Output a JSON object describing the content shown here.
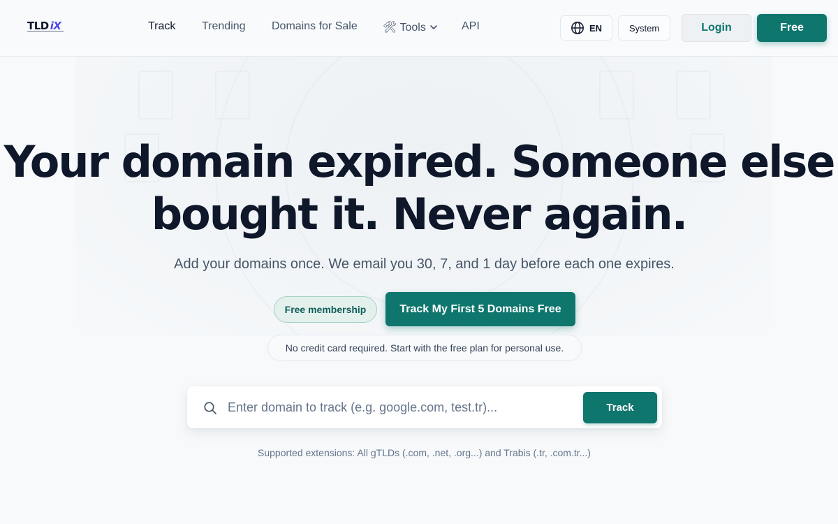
{
  "brand": {
    "logo_text": "TLD",
    "logo_accent": "iX"
  },
  "nav": {
    "items": [
      {
        "label": "Track"
      },
      {
        "label": "Trending"
      },
      {
        "label": "Domains for Sale"
      },
      {
        "label": "🛠 Tools"
      },
      {
        "label": "API"
      }
    ]
  },
  "header": {
    "lang_label": "EN",
    "theme_label": "System",
    "login_label": "Login",
    "free_label": "Free"
  },
  "hero": {
    "headline_line1": "Your domain expired. Someone else",
    "headline_line2": "bought it. Never again.",
    "subhead": "Add your domains once. We email you 30, 7, and 1 day before each one expires.",
    "pill_label": "Free membership",
    "cta_label": "Track My First 5 Domains Free",
    "note": "No credit card required. Start with the free plan for personal use."
  },
  "search": {
    "placeholder": "Enter domain to track (e.g. google.com, test.tr)...",
    "value": "",
    "button_label": "Track"
  },
  "supported_text": "Supported extensions: All gTLDs (.com, .net, .org...) and Trabis (.tr, .com.tr...)",
  "colors": {
    "accent": "#0f766e",
    "text_dark": "#0f172a",
    "text_muted": "#475569",
    "background": "#f7f9fb",
    "logo_accent": "#4f46e5"
  },
  "icons": [
    "globe-icon",
    "chevron-down-icon",
    "search-icon"
  ]
}
